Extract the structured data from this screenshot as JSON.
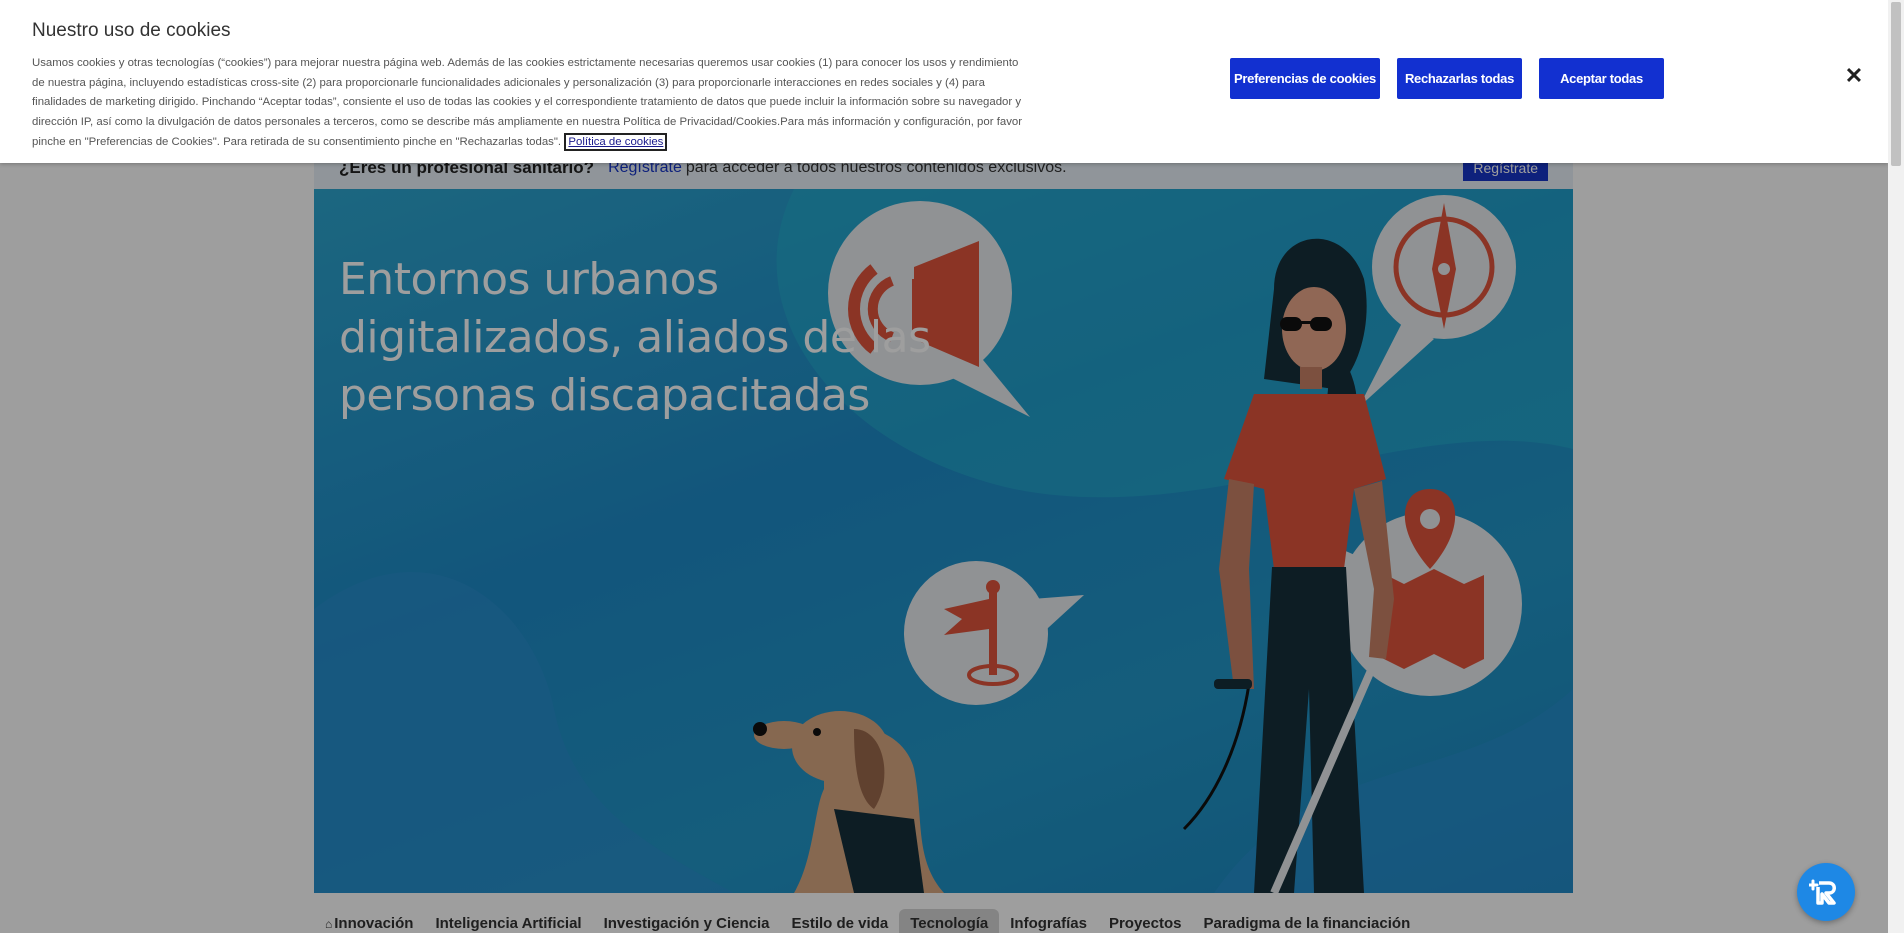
{
  "page": {
    "pro_bar": {
      "question": "¿Eres un profesional sanitario?",
      "register_link": "Regístrate",
      "register_text": "para acceder a todos nuestros contenidos exclusivos.",
      "register_button": "Regístrate"
    },
    "hero": {
      "title": "Entornos urbanos digitalizados, aliados de las personas discapacitadas"
    },
    "nav": {
      "home_icon": "home-icon",
      "items": [
        {
          "label": "Innovación"
        },
        {
          "label": "Inteligencia Artificial"
        },
        {
          "label": "Investigación y Ciencia"
        },
        {
          "label": "Estilo de vida"
        },
        {
          "label": "Tecnología"
        },
        {
          "label": "Infografías"
        },
        {
          "label": "Proyectos"
        },
        {
          "label": "Paradigma de la financiación"
        }
      ],
      "active": "Tecnología"
    }
  },
  "cookie_banner": {
    "title": "Nuestro uso de cookies",
    "text": "Usamos cookies y otras tecnologías (“cookies”) para mejorar nuestra página web. Además de las cookies estrictamente necesarias queremos usar cookies (1) para conocer los usos y rendimiento de nuestra página, incluyendo estadísticas cross-site (2) para proporcionarle funcionalidades adicionales y personalización (3) para proporcionarle interacciones en redes sociales y (4) para finalidades de marketing dirigido. Pinchando “Aceptar todas”, consiente el uso de todas las cookies y el correspondiente tratamiento de datos que puede incluir la información sobre su navegador y dirección IP, así como la divulgación de datos personales a terceros, como se describe más ampliamente en nuestra Política de Privacidad/Cookies.Para más información y configuración, por favor pinche en \"Preferencias de Cookies\". Para retirada de su consentimiento pinche en \"Rechazarlas todas\".",
    "policy_link": "Política de cookies",
    "buttons": {
      "preferences": "Preferencias de cookies",
      "reject": "Rechazarlas todas",
      "accept": "Aceptar todas"
    },
    "close_icon": "close-icon"
  },
  "colors": {
    "primary_button": "#1230d0",
    "hero_blue": "#1e8bc8",
    "illustration_red": "#e0553d"
  }
}
